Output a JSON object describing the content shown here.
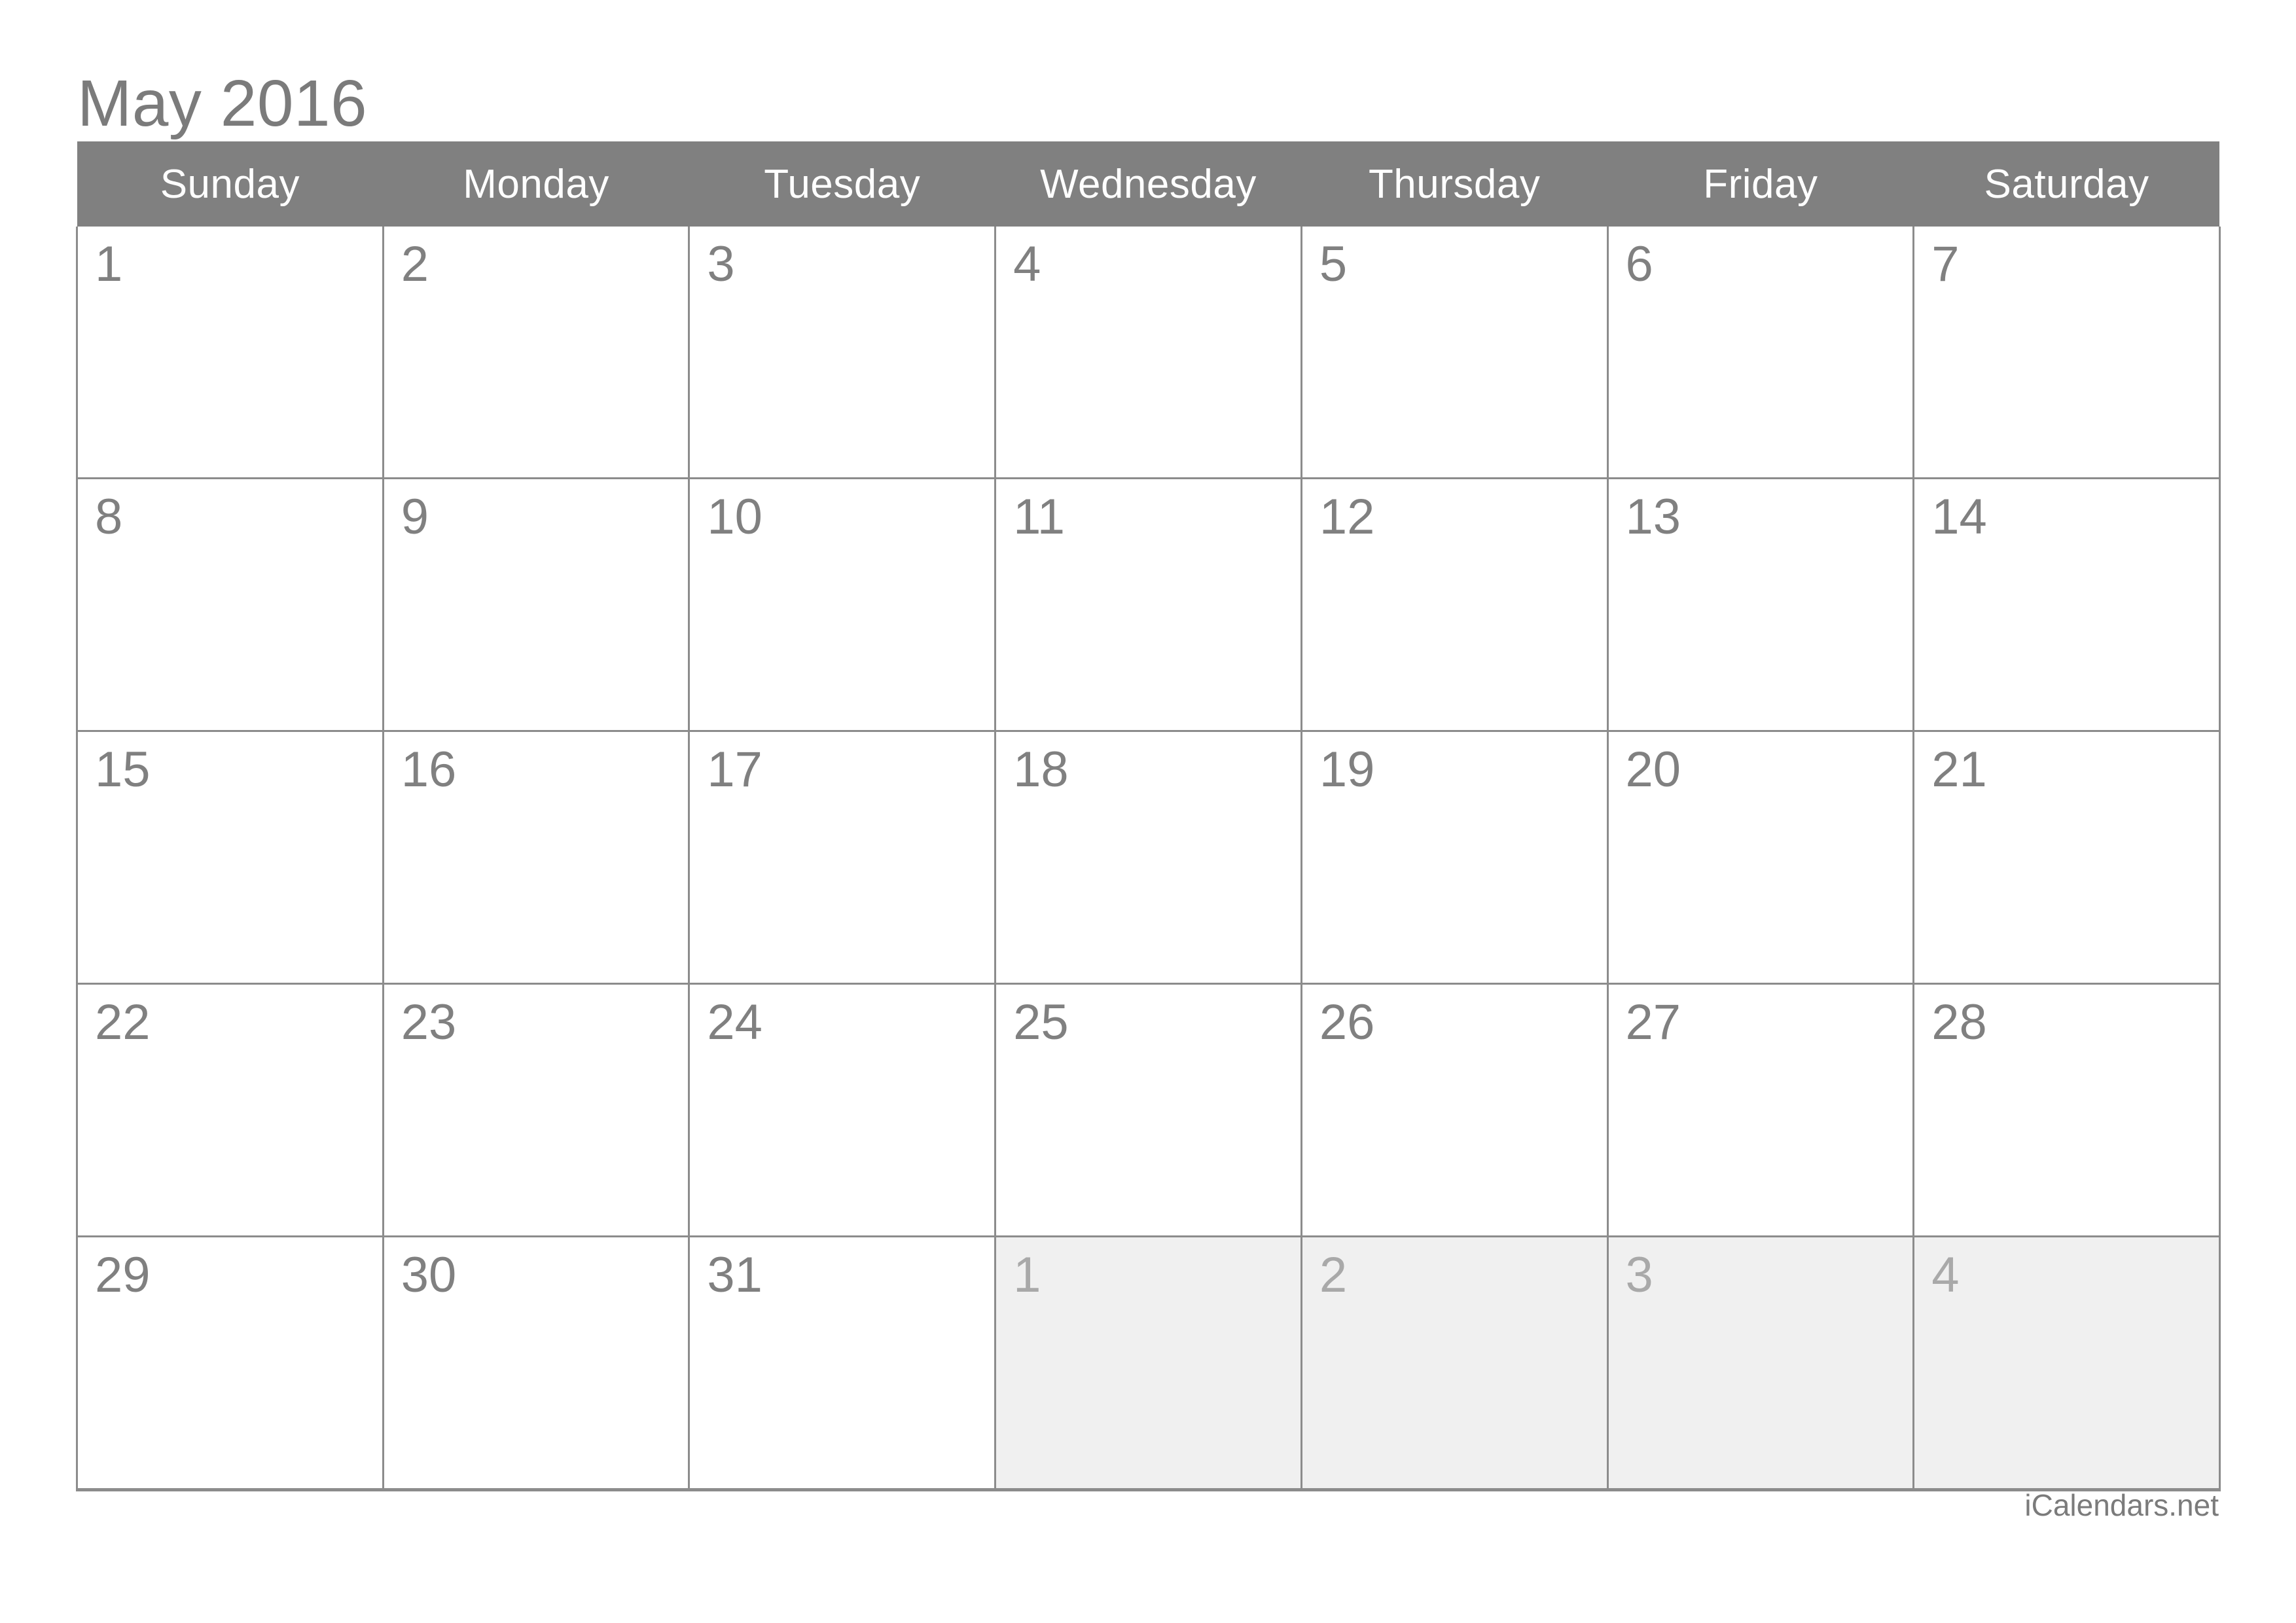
{
  "calendar": {
    "title": "May 2016",
    "month": "May",
    "year": "2016",
    "weekday_headers": [
      "Sunday",
      "Monday",
      "Tuesday",
      "Wednesday",
      "Thursday",
      "Friday",
      "Saturday"
    ],
    "weeks": [
      [
        {
          "day": "1",
          "other_month": false
        },
        {
          "day": "2",
          "other_month": false
        },
        {
          "day": "3",
          "other_month": false
        },
        {
          "day": "4",
          "other_month": false
        },
        {
          "day": "5",
          "other_month": false
        },
        {
          "day": "6",
          "other_month": false
        },
        {
          "day": "7",
          "other_month": false
        }
      ],
      [
        {
          "day": "8",
          "other_month": false
        },
        {
          "day": "9",
          "other_month": false
        },
        {
          "day": "10",
          "other_month": false
        },
        {
          "day": "11",
          "other_month": false
        },
        {
          "day": "12",
          "other_month": false
        },
        {
          "day": "13",
          "other_month": false
        },
        {
          "day": "14",
          "other_month": false
        }
      ],
      [
        {
          "day": "15",
          "other_month": false
        },
        {
          "day": "16",
          "other_month": false
        },
        {
          "day": "17",
          "other_month": false
        },
        {
          "day": "18",
          "other_month": false
        },
        {
          "day": "19",
          "other_month": false
        },
        {
          "day": "20",
          "other_month": false
        },
        {
          "day": "21",
          "other_month": false
        }
      ],
      [
        {
          "day": "22",
          "other_month": false
        },
        {
          "day": "23",
          "other_month": false
        },
        {
          "day": "24",
          "other_month": false
        },
        {
          "day": "25",
          "other_month": false
        },
        {
          "day": "26",
          "other_month": false
        },
        {
          "day": "27",
          "other_month": false
        },
        {
          "day": "28",
          "other_month": false
        }
      ],
      [
        {
          "day": "29",
          "other_month": false
        },
        {
          "day": "30",
          "other_month": false
        },
        {
          "day": "31",
          "other_month": false
        },
        {
          "day": "1",
          "other_month": true
        },
        {
          "day": "2",
          "other_month": true
        },
        {
          "day": "3",
          "other_month": true
        },
        {
          "day": "4",
          "other_month": true
        }
      ]
    ]
  },
  "footer": {
    "brand": "iCalendars.net"
  },
  "colors": {
    "header_band": "#808080",
    "header_text": "#ffffff",
    "title_text": "#7b7b7b",
    "day_number": "#808080",
    "day_number_muted": "#a9a9a9",
    "cell_border": "#8c8c8c",
    "cell_background": "#ffffff",
    "cell_background_muted": "#f0f0f0",
    "page_background": "#ffffff"
  }
}
